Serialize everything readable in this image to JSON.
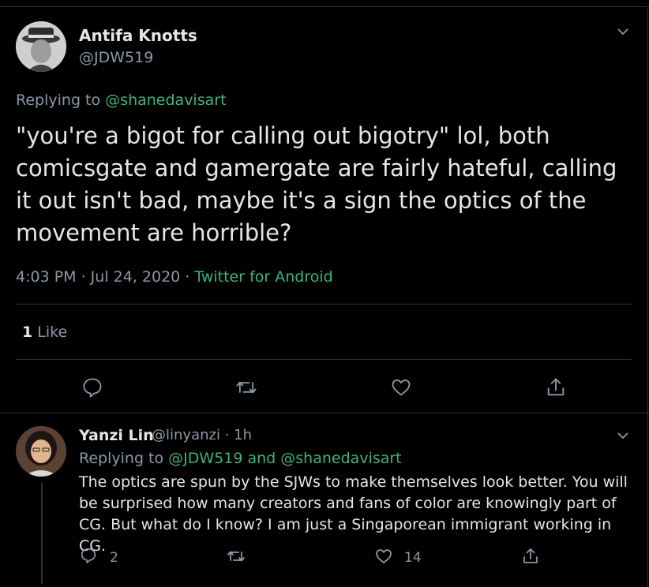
{
  "main_tweet": {
    "author_name": "Antifa Knotts",
    "author_handle": "@JDW519",
    "replying_prefix": "Replying to",
    "replying_to": "@shanedavisart",
    "text": "\"you're a bigot for calling out bigotry\" lol, both comicsgate and gamergate are fairly hateful, calling it out isn't bad, maybe it's a sign the optics of the movement are horrible?",
    "time": "4:03 PM · Jul 24, 2020 · ",
    "source": "Twitter for Android",
    "like_count": "1",
    "like_label": "Like",
    "icons": [
      "reply-icon",
      "retweet-icon",
      "like-icon",
      "share-icon",
      "chevron-down-icon"
    ]
  },
  "reply_tweet": {
    "author_name": "Yanzi Lin",
    "author_handle": "@linyanzi · 1h",
    "replying_prefix": "Replying to",
    "replying_to": "@JDW519 and @shanedavisart",
    "text": "The optics are spun by the SJWs to make themselves look better. You will be surprised how many creators and fans of color are knowingly part of CG. But what do I know? I am just a Singaporean immigrant working in CG.",
    "reply_count": "2",
    "like_count": "14"
  },
  "colors": {
    "background": "#000000",
    "text": "#e6e6e6",
    "muted": "#8b98a5",
    "accent": "#3fb27f",
    "divider": "#2f3336"
  }
}
